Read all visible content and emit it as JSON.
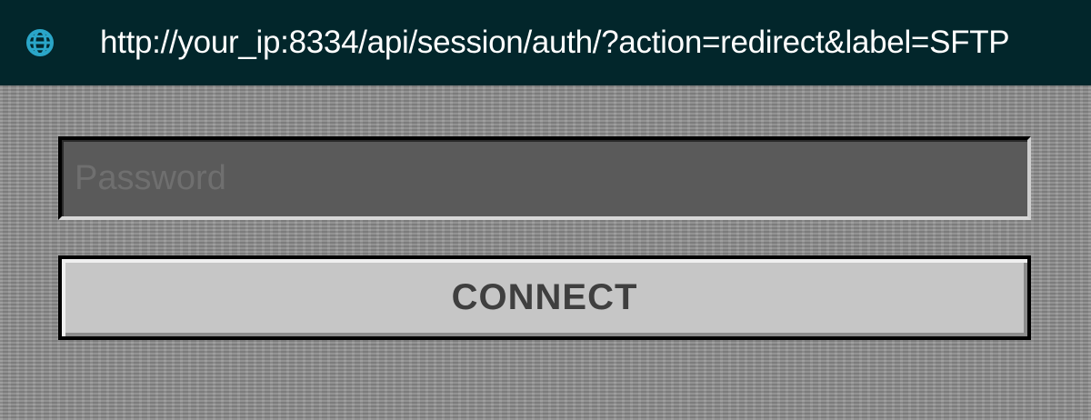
{
  "address_bar": {
    "icon": "globe-icon",
    "url": "http://your_ip:8334/api/session/auth/?action=redirect&label=SFTP",
    "background": "#02262b",
    "icon_color": "#2aa6c8"
  },
  "login": {
    "password_placeholder": "Password",
    "password_value": "",
    "connect_label": "CONNECT"
  }
}
